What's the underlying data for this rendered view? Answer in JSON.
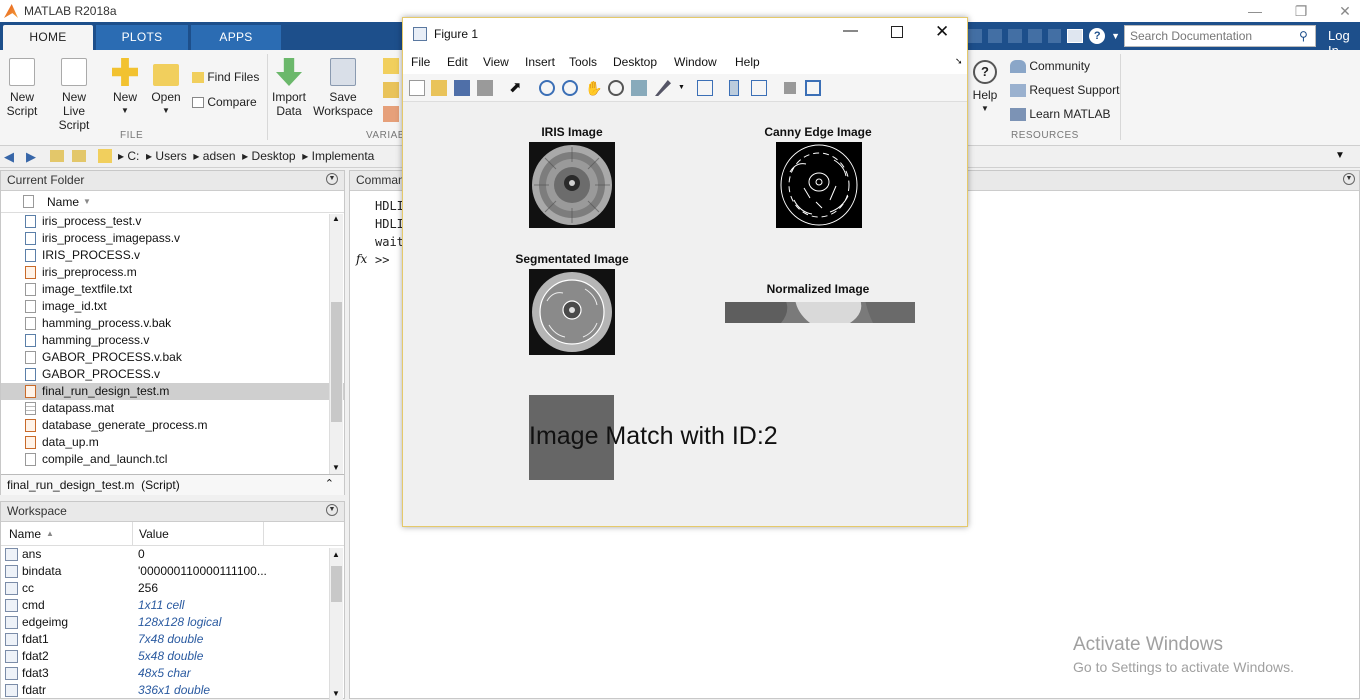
{
  "app": {
    "title": "MATLAB R2018a",
    "search_placeholder": "Search Documentation",
    "login": "Log In"
  },
  "tabs": [
    "HOME",
    "PLOTS",
    "APPS"
  ],
  "ribbon": {
    "new_script": "New\nScript",
    "new_live_script": "New\nLive Script",
    "new": "New",
    "open": "Open",
    "find_files": "Find Files",
    "compare": "Compare",
    "import_data": "Import\nData",
    "save_workspace": "Save\nWorkspace",
    "group_file": "FILE",
    "group_variable": "VARIABL",
    "help": "Help",
    "community": "Community",
    "request_support": "Request Support",
    "learn_matlab": "Learn MATLAB",
    "group_resources": "RESOURCES"
  },
  "address": {
    "path": [
      "C:",
      "Users",
      "adsen",
      "Desktop",
      "Implementa"
    ]
  },
  "current_folder": {
    "title": "Current Folder",
    "col_name": "Name",
    "files": [
      {
        "name": "iris_process_test.v",
        "type": "v"
      },
      {
        "name": "iris_process_imagepass.v",
        "type": "v"
      },
      {
        "name": "IRIS_PROCESS.v",
        "type": "v"
      },
      {
        "name": "iris_preprocess.m",
        "type": "m"
      },
      {
        "name": "image_textfile.txt",
        "type": "txt"
      },
      {
        "name": "image_id.txt",
        "type": "txt"
      },
      {
        "name": "hamming_process.v.bak",
        "type": "txt"
      },
      {
        "name": "hamming_process.v",
        "type": "v"
      },
      {
        "name": "GABOR_PROCESS.v.bak",
        "type": "txt"
      },
      {
        "name": "GABOR_PROCESS.v",
        "type": "v"
      },
      {
        "name": "final_run_design_test.m",
        "type": "m",
        "selected": true
      },
      {
        "name": "datapass.mat",
        "type": "mat"
      },
      {
        "name": "database_generate_process.m",
        "type": "m"
      },
      {
        "name": "data_up.m",
        "type": "m"
      },
      {
        "name": "compile_and_launch.tcl",
        "type": "txt"
      }
    ],
    "details": "final_run_design_test.m  (Script)"
  },
  "workspace": {
    "title": "Workspace",
    "col_name": "Name",
    "col_value": "Value",
    "vars": [
      {
        "name": "ans",
        "value": "0",
        "italic": false
      },
      {
        "name": "bindata",
        "value": "'000000110000111100...",
        "italic": false
      },
      {
        "name": "cc",
        "value": "256",
        "italic": false
      },
      {
        "name": "cmd",
        "value": "1x11 cell",
        "italic": true
      },
      {
        "name": "edgeimg",
        "value": "128x128 logical",
        "italic": true
      },
      {
        "name": "fdat1",
        "value": "7x48 double",
        "italic": true
      },
      {
        "name": "fdat2",
        "value": "5x48 double",
        "italic": true
      },
      {
        "name": "fdat3",
        "value": "48x5 char",
        "italic": true
      },
      {
        "name": "fdatr",
        "value": "336x1 double",
        "italic": true
      }
    ]
  },
  "command_window": {
    "title": "Comman",
    "lines": [
      "HDLI",
      "HDLI",
      "wait"
    ],
    "prompt": ">>",
    "fx": "fx"
  },
  "figure": {
    "title": "Figure 1",
    "menu": [
      "File",
      "Edit",
      "View",
      "Insert",
      "Tools",
      "Desktop",
      "Window",
      "Help"
    ],
    "axes": {
      "iris": "IRIS Image",
      "canny": "Canny Edge Image",
      "segmented": "Segmentated Image",
      "normalized": "Normalized Image"
    },
    "match_text": "Image Match with ID:2"
  },
  "watermark": {
    "line1": "Activate Windows",
    "line2": "Go to Settings to activate Windows."
  },
  "colors": {
    "tab_bar": "#1d4f8b",
    "figure_border": "#e5c96a",
    "selection": "#cfcfcf"
  }
}
